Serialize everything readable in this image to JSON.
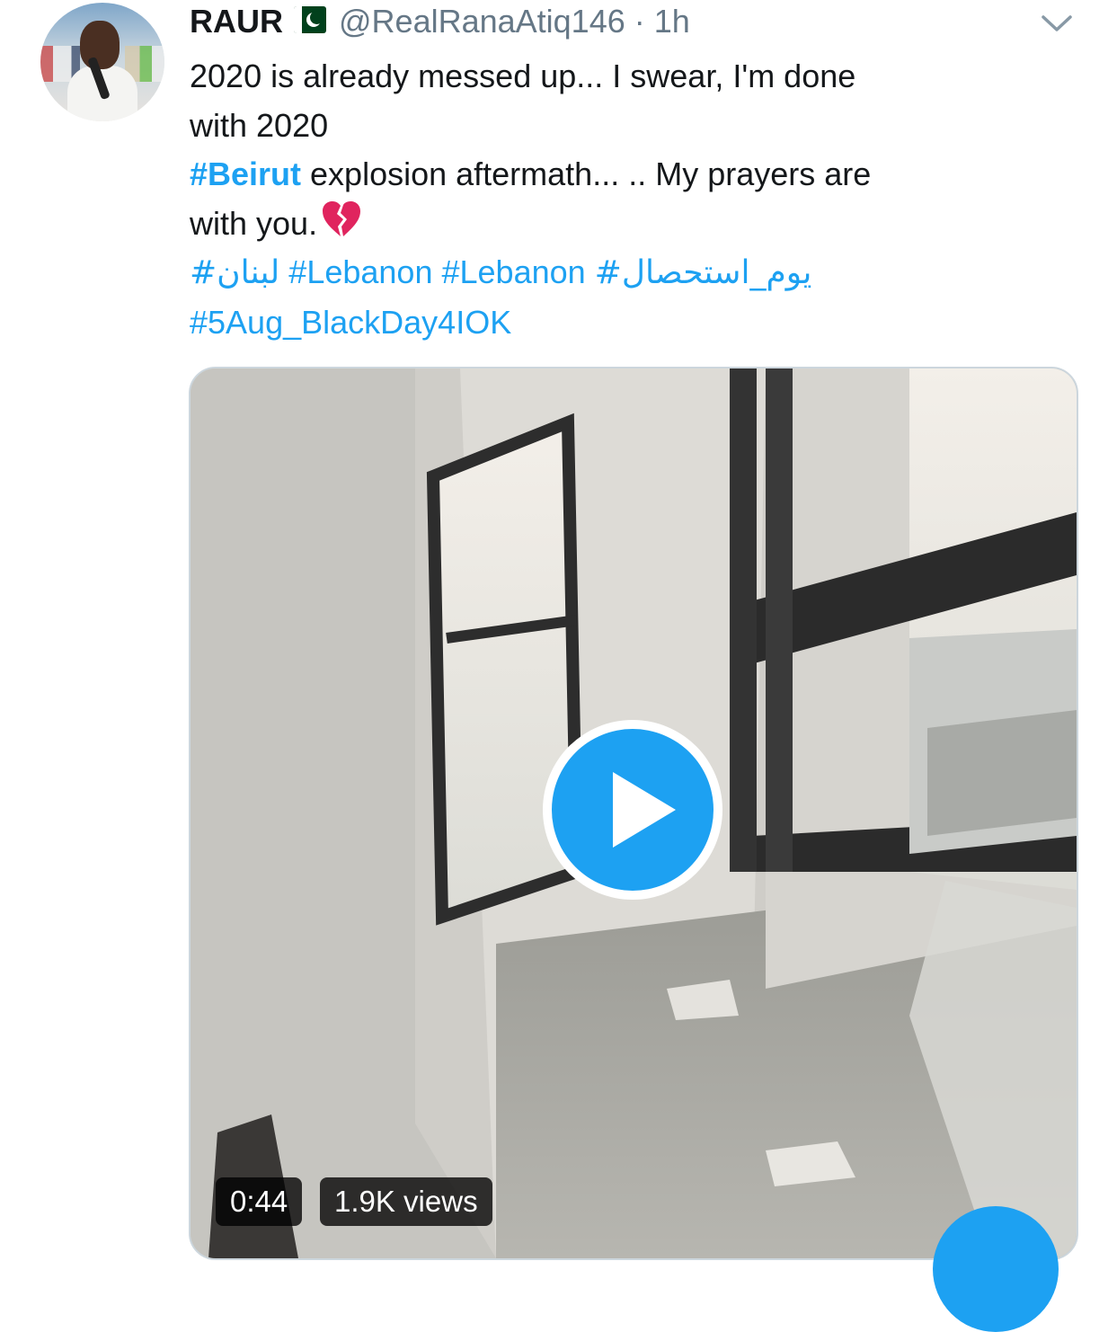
{
  "author": {
    "name": "RAUR",
    "handle": "@RealRanaAtiq146",
    "separator": "·",
    "time": "1h",
    "flag_icon": "pakistan-flag-icon"
  },
  "tweet": {
    "line1": "2020 is already messed up... I swear,  I'm done",
    "line2": "with 2020",
    "line3_hashtag": "#Beirut",
    "line3_rest": " explosion aftermath... .. My prayers are",
    "line4": "with you.",
    "heart_icon": "broken-heart-icon",
    "line5_urdu_1": "#لبنان",
    "line5_tag1": "#Lebanon",
    "line5_tag2": "#Lebanon",
    "line5_urdu_2": "#یوم_استحصال",
    "line6": "#5Aug_BlackDay4IOK"
  },
  "video": {
    "duration": "0:44",
    "views": "1.9K views"
  },
  "colors": {
    "accent": "#1da1f2",
    "text": "#14171a",
    "muted": "#657786",
    "border": "#ccd6dd"
  }
}
